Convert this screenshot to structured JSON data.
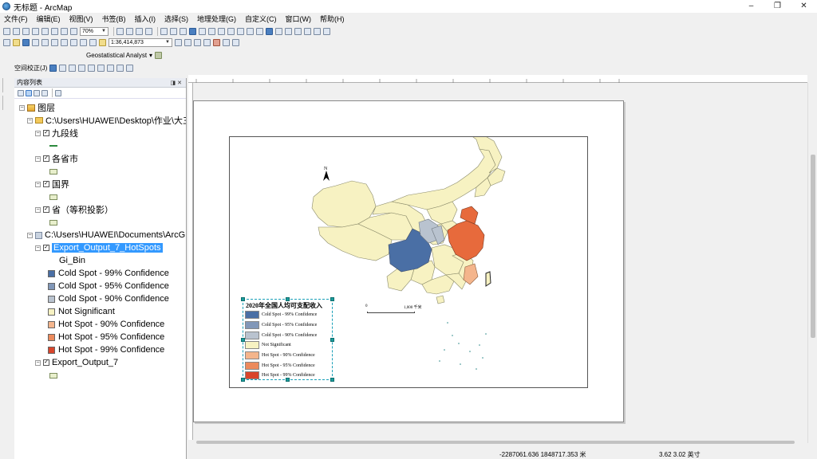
{
  "window": {
    "title": "无标题 - ArcMap",
    "controls": [
      "–",
      "❐",
      "✕"
    ]
  },
  "menu": [
    "文件(F)",
    "编辑(E)",
    "视图(V)",
    "书签(B)",
    "插入(I)",
    "选择(S)",
    "地理处理(G)",
    "自定义(C)",
    "窗口(W)",
    "帮助(H)"
  ],
  "toolbar": {
    "zoom_percent": "70%",
    "scale": "1:36,414,873"
  },
  "geostat_toolbar": {
    "label": "Geostatistical Analyst"
  },
  "spatial_adjust_toolbar": {
    "label": "空间校正(J)"
  },
  "toc": {
    "header": "内容列表",
    "root_label": "图层",
    "groups": [
      {
        "path": "C:\\Users\\HUAWEI\\Desktop\\作业\\大三",
        "layers": [
          "九段线",
          "各省市",
          "国界",
          "省（等积投影）"
        ]
      },
      {
        "path": "C:\\Users\\HUAWEI\\Documents\\ArcG",
        "layers": [
          "Export_Output_7_HotSpots",
          "Export_Output_7"
        ]
      }
    ],
    "field_label": "Gi_Bin",
    "classes": [
      {
        "label": "Cold Spot - 99% Confidence",
        "color": "#4a6fa5"
      },
      {
        "label": "Cold Spot - 95% Confidence",
        "color": "#8197b8"
      },
      {
        "label": "Cold Spot - 90% Confidence",
        "color": "#b9c3cf"
      },
      {
        "label": "Not Significant",
        "color": "#f7f2c2"
      },
      {
        "label": "Hot Spot - 90% Confidence",
        "color": "#f4b58c"
      },
      {
        "label": "Hot Spot - 95% Confidence",
        "color": "#ec8a5c"
      },
      {
        "label": "Hot Spot - 99% Confidence",
        "color": "#d9452b"
      }
    ]
  },
  "map": {
    "legend_title": "2020年全国人均可支配收入",
    "scale_labels": [
      "0",
      "1,000 千米"
    ],
    "colors": {
      "province_default": "#f7f2c2",
      "province_border": "#8a8a6a",
      "cold99": "#4a6fa5",
      "cold90": "#b9c3cf",
      "hot99": "#e76a3c",
      "hot90": "#f4b58c"
    }
  },
  "status": {
    "coords": "-2287061.636  1848717.353 米",
    "page_coords": "3.62  3.02 英寸"
  }
}
